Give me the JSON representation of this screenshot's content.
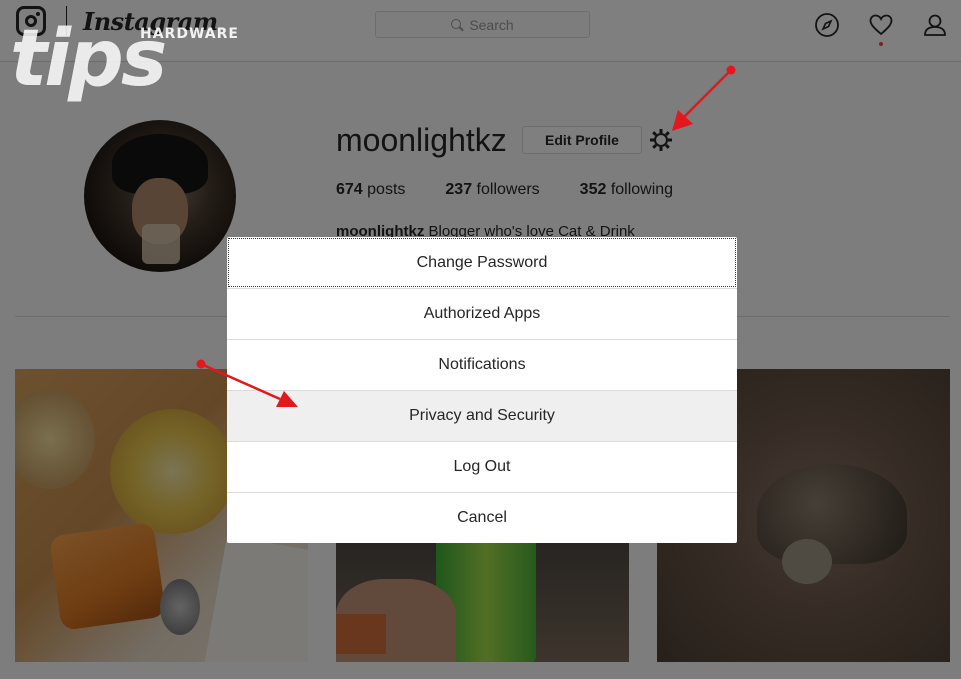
{
  "nav": {
    "brand": "Instagram",
    "search_placeholder": "Search"
  },
  "profile": {
    "username": "moonlightkz",
    "edit_label": "Edit Profile",
    "stats": [
      {
        "count": "674",
        "label": " posts"
      },
      {
        "count": "237",
        "label": " followers"
      },
      {
        "count": "352",
        "label": " following"
      }
    ],
    "bio_name": "moonlightkz",
    "bio_text": " Blogger who's love Cat & Drink"
  },
  "modal": {
    "items": [
      {
        "label": "Change Password"
      },
      {
        "label": "Authorized Apps"
      },
      {
        "label": "Notifications"
      },
      {
        "label": "Privacy and Security"
      },
      {
        "label": "Log Out"
      },
      {
        "label": "Cancel"
      }
    ],
    "highlighted": "Privacy and Security"
  },
  "watermark": {
    "big": "tips",
    "small": "HARDWARE"
  },
  "colors": {
    "arrow": "#e4171c",
    "notification_dot": "#ed4956"
  },
  "icons": {
    "brand": "instagram-camera-icon",
    "search": "search-icon",
    "explore": "compass-icon",
    "activity": "heart-icon",
    "profile": "user-icon",
    "settings": "gear-icon"
  }
}
